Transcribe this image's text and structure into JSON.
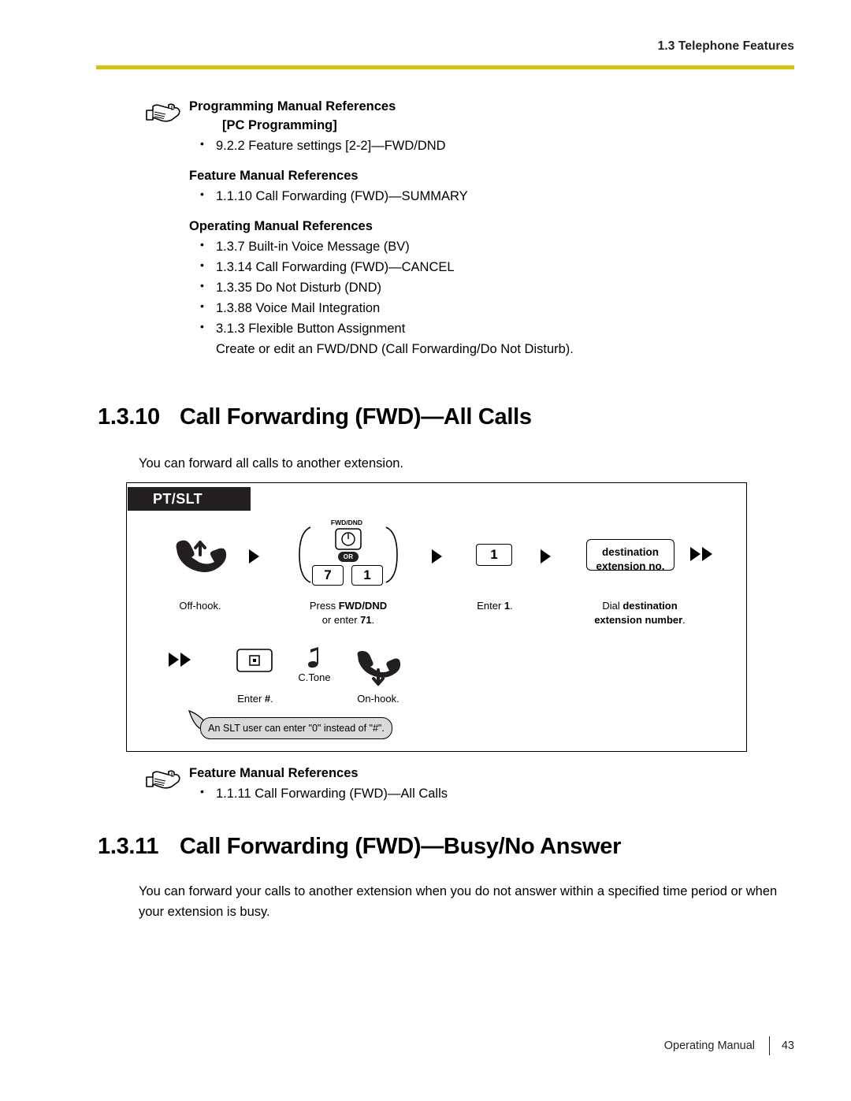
{
  "header": {
    "section_label": "1.3 Telephone Features"
  },
  "ref_block_1": {
    "title": "Programming Manual References",
    "subtitle": "[PC Programming]",
    "items": [
      "9.2.2 Feature settings [2-2]—FWD/DND"
    ],
    "title2": "Feature Manual References",
    "items2": [
      "1.1.10 Call Forwarding (FWD)—SUMMARY"
    ],
    "title3": "Operating Manual References",
    "items3": [
      "1.3.7 Built-in Voice Message (BV)",
      "1.3.14 Call Forwarding (FWD)—CANCEL",
      "1.3.35 Do Not Disturb (DND)",
      "1.3.88 Voice Mail Integration",
      "3.1.3 Flexible Button Assignment"
    ],
    "items3_note": "Create or edit an FWD/DND (Call Forwarding/Do Not Disturb)."
  },
  "section_1": {
    "number": "1.3.10",
    "title": "Call Forwarding (FWD)—All Calls",
    "body": "You can forward all calls to another extension."
  },
  "figure": {
    "tab_label": "PT/SLT",
    "fwd_dnd_label": "FWD/DND",
    "or_label": "OR",
    "key_7": "7",
    "key_1": "1",
    "key_one": "1",
    "dest_line1": "destination",
    "dest_line2": "extension no.",
    "cap_offhook": "Off-hook.",
    "cap_press_prefix": "Press ",
    "cap_press_bold": "FWD/DND",
    "cap_press_line2_prefix": "or enter ",
    "cap_press_line2_bold": "71",
    "cap_press_line2_suffix": ".",
    "cap_enter1_prefix": "Enter ",
    "cap_enter1_bold": "1",
    "cap_enter1_suffix": ".",
    "cap_dial_prefix": "Dial ",
    "cap_dial_bold": "destination",
    "cap_dial_line2_bold": "extension number",
    "cap_dial_line2_suffix": ".",
    "cap_enter_hash_prefix": "Enter ",
    "cap_enter_hash_bold": "#",
    "cap_enter_hash_suffix": ".",
    "cap_ctone": "C.Tone",
    "cap_onhook": "On-hook.",
    "callout": "An SLT user can enter \"0\" instead of \"#\"."
  },
  "ref_block_2": {
    "title": "Feature Manual References",
    "items": [
      "1.1.11 Call Forwarding (FWD)—All Calls"
    ]
  },
  "section_2": {
    "number": "1.3.11",
    "title": "Call Forwarding (FWD)—Busy/No Answer",
    "body": "You can forward your calls to another extension when you do not answer within a specified time period or when your extension is busy."
  },
  "footer": {
    "manual": "Operating Manual",
    "page": "43"
  },
  "colors": {
    "rule": "#d8c20a",
    "tab_bg": "#231f20",
    "callout_bg": "#d9d9d9"
  }
}
